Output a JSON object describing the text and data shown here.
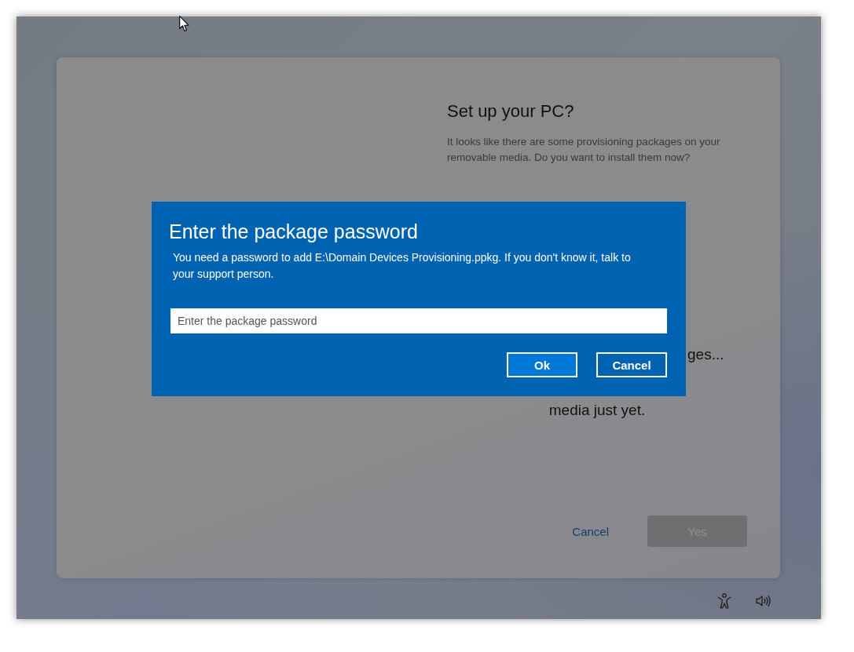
{
  "setup_page": {
    "title": "Set up your PC?",
    "description": "It looks like there are some provisioning packages on your removable media. Do you want to install them now?",
    "status_lines": [
      "ges...",
      "media just yet."
    ],
    "actions": [
      {
        "label": "Cancel",
        "kind": "link",
        "disabled": false
      },
      {
        "label": "Yes",
        "kind": "button",
        "disabled": true
      }
    ]
  },
  "dialog": {
    "title": "Enter the package password",
    "message": "You need a password to add E:\\Domain Devices Provisioning.ppkg. If you don't know it, talk to your support person.",
    "password_field": {
      "placeholder": "Enter the package password"
    },
    "buttons": [
      {
        "label": "Ok",
        "kind": "primary"
      },
      {
        "label": "Cancel",
        "kind": "secondary"
      }
    ]
  }
}
